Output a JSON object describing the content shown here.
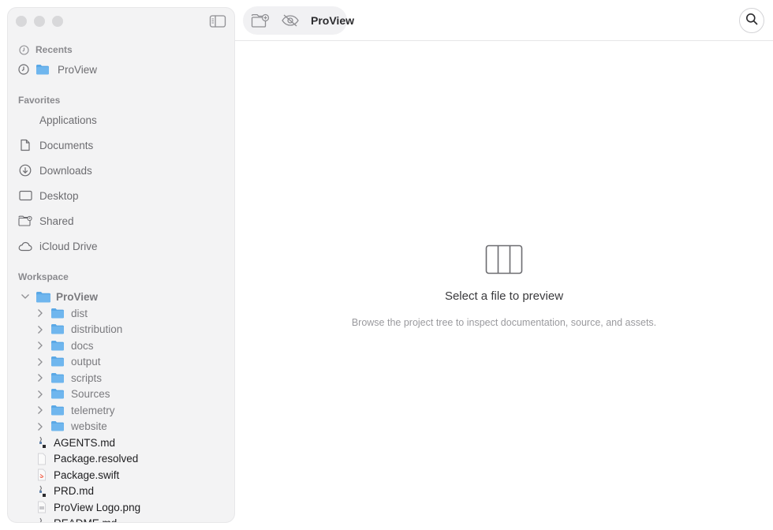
{
  "toolbar": {
    "title": "ProView"
  },
  "sidebar": {
    "recents_label": "Recents",
    "recent_item": "ProView",
    "favorites_label": "Favorites",
    "favorites": [
      {
        "label": "Applications",
        "icon": "applications-icon"
      },
      {
        "label": "Documents",
        "icon": "document-icon"
      },
      {
        "label": "Downloads",
        "icon": "download-icon"
      },
      {
        "label": "Desktop",
        "icon": "desktop-icon"
      },
      {
        "label": "Shared",
        "icon": "shared-folder-icon"
      },
      {
        "label": "iCloud Drive",
        "icon": "cloud-icon"
      }
    ],
    "workspace_label": "Workspace",
    "root_folder": "ProView",
    "folders": [
      "dist",
      "distribution",
      "docs",
      "output",
      "scripts",
      "Sources",
      "telemetry",
      "website"
    ],
    "files": [
      "AGENTS.md",
      "Package.resolved",
      "Package.swift",
      "PRD.md",
      "ProView Logo.png",
      "README.md"
    ]
  },
  "preview": {
    "title": "Select a file to preview",
    "subtitle": "Browse the project tree to inspect documentation, source, and assets."
  },
  "colors": {
    "folder_blue": "#5aa8e6",
    "sidebar_bg": "#f3f3f4"
  }
}
